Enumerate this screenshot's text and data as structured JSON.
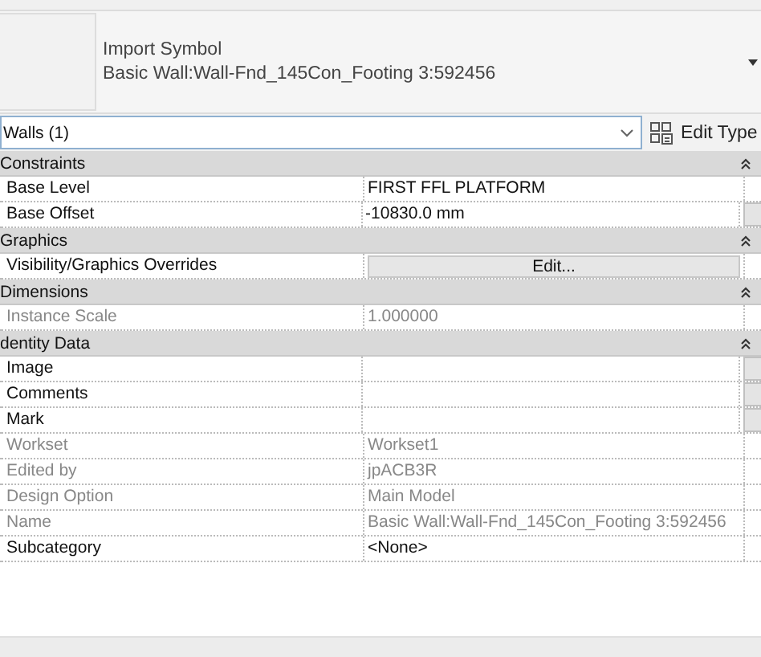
{
  "header": {
    "line_1": "Import Symbol",
    "line_2": "Basic Wall:Wall-Fnd_145Con_Footing 3:592456"
  },
  "selector": {
    "value": "Walls (1)",
    "edit_type": "Edit Type"
  },
  "sections": [
    {
      "title": "Constraints",
      "expanded": true,
      "rows": [
        {
          "kind": "text",
          "label": "Base Level",
          "value": "FIRST FFL PLATFORM",
          "disabled": false,
          "side_button": false
        },
        {
          "kind": "text",
          "label": "Base Offset",
          "value": "-10830.0 mm",
          "disabled": false,
          "side_button": true
        }
      ]
    },
    {
      "title": "Graphics",
      "expanded": true,
      "rows": [
        {
          "kind": "button",
          "label": "Visibility/Graphics Overrides",
          "value": "Edit...",
          "disabled": false,
          "side_button": false
        }
      ]
    },
    {
      "title": "Dimensions",
      "expanded": true,
      "rows": [
        {
          "kind": "text",
          "label": "Instance Scale",
          "value": "1.000000",
          "disabled": true,
          "side_button": false
        }
      ]
    },
    {
      "title": "dentity Data",
      "expanded": true,
      "rows": [
        {
          "kind": "text",
          "label": "Image",
          "value": "",
          "disabled": false,
          "side_button": true
        },
        {
          "kind": "text",
          "label": "Comments",
          "value": "",
          "disabled": false,
          "side_button": true
        },
        {
          "kind": "text",
          "label": "Mark",
          "value": "",
          "disabled": false,
          "side_button": true
        },
        {
          "kind": "text",
          "label": "Workset",
          "value": "Workset1",
          "disabled": true,
          "side_button": false
        },
        {
          "kind": "text",
          "label": "Edited by",
          "value": "jpACB3R",
          "disabled": true,
          "side_button": false
        },
        {
          "kind": "text",
          "label": "Design Option",
          "value": "Main Model",
          "disabled": true,
          "side_button": false
        },
        {
          "kind": "text",
          "label": "Name",
          "value": "Basic Wall:Wall-Fnd_145Con_Footing 3:592456",
          "disabled": true,
          "side_button": false
        },
        {
          "kind": "text",
          "label": "Subcategory",
          "value": "<None>",
          "disabled": false,
          "side_button": false
        }
      ]
    }
  ]
}
